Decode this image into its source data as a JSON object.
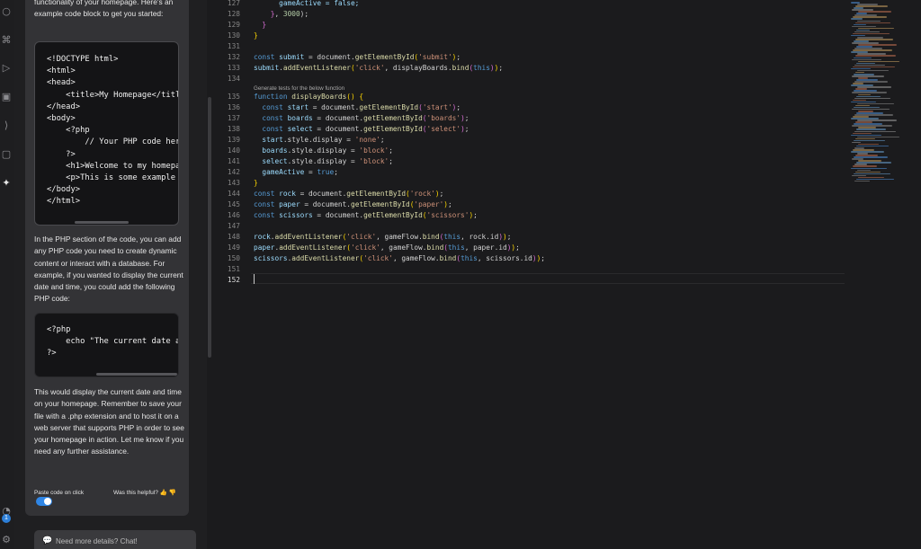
{
  "activity_bar": {
    "icons": [
      {
        "name": "search-icon",
        "glyph": "○"
      },
      {
        "name": "source-control-icon",
        "glyph": "⌘"
      },
      {
        "name": "run-debug-icon",
        "glyph": "▷"
      },
      {
        "name": "extensions-icon",
        "glyph": "▣"
      },
      {
        "name": "brackets-icon",
        "glyph": "⟩"
      },
      {
        "name": "remote-explorer-icon",
        "glyph": "▢"
      },
      {
        "name": "ai-chat-icon",
        "glyph": "✦"
      }
    ],
    "account_icon": "◔",
    "account_badge": "1",
    "settings_icon": "⚙"
  },
  "chat": {
    "intro": "functionality of your homepage. Here's an example code block to get you started:",
    "code_block_1": "<!DOCTYPE html>\n<html>\n<head>\n    <title>My Homepage</title>\n</head>\n<body>\n    <?php\n        // Your PHP code here\n    ?>\n    <h1>Welcome to my homepage</h1>\n    <p>This is some example text.</p>\n</body>\n</html>",
    "paragraph_2": "In the PHP section of the code, you can add any PHP code you need to create dynamic content or interact with a database. For example, if you wanted to display the current date and time, you could add the following PHP code:",
    "code_block_2": "<?php\n    echo \"The current date and time is \" . date(\"Y-m-d H:i:s\");\n?>",
    "paragraph_3": "This would display the current date and time on your homepage. Remember to save your file with a .php extension and to host it on a web server that supports PHP in order to see your homepage in action. Let me know if you need any further assistance.",
    "paste_label": "Paste code on click",
    "helpful_label": "Was this helpful?",
    "thumbs_up": "👍",
    "thumbs_down": "👎",
    "input_icon": "💬",
    "input_placeholder": "Need more details? Chat!"
  },
  "editor": {
    "hint": "Generate tests for the below function",
    "line_numbers": [
      "127",
      "128",
      "129",
      "130",
      "131",
      "132",
      "133",
      "134",
      "135",
      "136",
      "137",
      "138",
      "139",
      "140",
      "141",
      "142",
      "143",
      "144",
      "145",
      "146",
      "147",
      "148",
      "149",
      "150",
      "151",
      "152"
    ],
    "current_line": "152",
    "lines": [
      [
        {
          "t": "      gameActive = false;",
          "c": "var"
        }
      ],
      [
        {
          "t": "    ",
          "c": ""
        },
        {
          "t": "}",
          "c": "br2"
        },
        {
          "t": ", ",
          "c": ""
        },
        {
          "t": "3000",
          "c": "num"
        },
        {
          "t": ");",
          "c": ""
        }
      ],
      [
        {
          "t": "  ",
          "c": ""
        },
        {
          "t": "}",
          "c": "br2"
        }
      ],
      [
        {
          "t": "}",
          "c": "br1"
        }
      ],
      [],
      [
        {
          "t": "const ",
          "c": "kw"
        },
        {
          "t": "submit",
          "c": "var"
        },
        {
          "t": " = document.",
          "c": ""
        },
        {
          "t": "getElementById",
          "c": "fn"
        },
        {
          "t": "(",
          "c": "br1"
        },
        {
          "t": "'submit'",
          "c": "str"
        },
        {
          "t": ")",
          "c": "br1"
        },
        {
          "t": ";",
          "c": ""
        }
      ],
      [
        {
          "t": "submit",
          "c": "var"
        },
        {
          "t": ".",
          "c": ""
        },
        {
          "t": "addEventListener",
          "c": "fn"
        },
        {
          "t": "(",
          "c": "br1"
        },
        {
          "t": "'click'",
          "c": "str"
        },
        {
          "t": ", displayBoards.",
          "c": ""
        },
        {
          "t": "bind",
          "c": "fn"
        },
        {
          "t": "(",
          "c": "br2"
        },
        {
          "t": "this",
          "c": "kw"
        },
        {
          "t": ")",
          "c": "br2"
        },
        {
          "t": ")",
          "c": "br1"
        },
        {
          "t": ";",
          "c": ""
        }
      ],
      [],
      [
        {
          "t": "function ",
          "c": "kw"
        },
        {
          "t": "displayBoards",
          "c": "fn"
        },
        {
          "t": "() {",
          "c": "br1"
        }
      ],
      [
        {
          "t": "  const ",
          "c": "kw"
        },
        {
          "t": "start",
          "c": "var"
        },
        {
          "t": " = document.",
          "c": ""
        },
        {
          "t": "getElementById",
          "c": "fn"
        },
        {
          "t": "(",
          "c": "br2"
        },
        {
          "t": "'start'",
          "c": "str"
        },
        {
          "t": ")",
          "c": "br2"
        },
        {
          "t": ";",
          "c": ""
        }
      ],
      [
        {
          "t": "  const ",
          "c": "kw"
        },
        {
          "t": "boards",
          "c": "var"
        },
        {
          "t": " = document.",
          "c": ""
        },
        {
          "t": "getElementById",
          "c": "fn"
        },
        {
          "t": "(",
          "c": "br2"
        },
        {
          "t": "'boards'",
          "c": "str"
        },
        {
          "t": ")",
          "c": "br2"
        },
        {
          "t": ";",
          "c": ""
        }
      ],
      [
        {
          "t": "  const ",
          "c": "kw"
        },
        {
          "t": "select",
          "c": "var"
        },
        {
          "t": " = document.",
          "c": ""
        },
        {
          "t": "getElementById",
          "c": "fn"
        },
        {
          "t": "(",
          "c": "br2"
        },
        {
          "t": "'select'",
          "c": "str"
        },
        {
          "t": ")",
          "c": "br2"
        },
        {
          "t": ";",
          "c": ""
        }
      ],
      [
        {
          "t": "  start",
          "c": "var"
        },
        {
          "t": ".style.display = ",
          "c": ""
        },
        {
          "t": "'none'",
          "c": "str"
        },
        {
          "t": ";",
          "c": ""
        }
      ],
      [
        {
          "t": "  boards",
          "c": "var"
        },
        {
          "t": ".style.display = ",
          "c": ""
        },
        {
          "t": "'block'",
          "c": "str"
        },
        {
          "t": ";",
          "c": ""
        }
      ],
      [
        {
          "t": "  select",
          "c": "var"
        },
        {
          "t": ".style.display = ",
          "c": ""
        },
        {
          "t": "'block'",
          "c": "str"
        },
        {
          "t": ";",
          "c": ""
        }
      ],
      [
        {
          "t": "  gameActive",
          "c": "var"
        },
        {
          "t": " = ",
          "c": ""
        },
        {
          "t": "true",
          "c": "kw"
        },
        {
          "t": ";",
          "c": ""
        }
      ],
      [
        {
          "t": "}",
          "c": "br1"
        }
      ],
      [
        {
          "t": "const ",
          "c": "kw"
        },
        {
          "t": "rock",
          "c": "var"
        },
        {
          "t": " = document.",
          "c": ""
        },
        {
          "t": "getElementById",
          "c": "fn"
        },
        {
          "t": "(",
          "c": "br1"
        },
        {
          "t": "'rock'",
          "c": "str"
        },
        {
          "t": ")",
          "c": "br1"
        },
        {
          "t": ";",
          "c": ""
        }
      ],
      [
        {
          "t": "const ",
          "c": "kw"
        },
        {
          "t": "paper",
          "c": "var"
        },
        {
          "t": " = document.",
          "c": ""
        },
        {
          "t": "getElementById",
          "c": "fn"
        },
        {
          "t": "(",
          "c": "br1"
        },
        {
          "t": "'paper'",
          "c": "str"
        },
        {
          "t": ")",
          "c": "br1"
        },
        {
          "t": ";",
          "c": ""
        }
      ],
      [
        {
          "t": "const ",
          "c": "kw"
        },
        {
          "t": "scissors",
          "c": "var"
        },
        {
          "t": " = document.",
          "c": ""
        },
        {
          "t": "getElementById",
          "c": "fn"
        },
        {
          "t": "(",
          "c": "br1"
        },
        {
          "t": "'scissors'",
          "c": "str"
        },
        {
          "t": ")",
          "c": "br1"
        },
        {
          "t": ";",
          "c": ""
        }
      ],
      [],
      [
        {
          "t": "rock",
          "c": "var"
        },
        {
          "t": ".",
          "c": ""
        },
        {
          "t": "addEventListener",
          "c": "fn"
        },
        {
          "t": "(",
          "c": "br1"
        },
        {
          "t": "'click'",
          "c": "str"
        },
        {
          "t": ", gameFlow.",
          "c": ""
        },
        {
          "t": "bind",
          "c": "fn"
        },
        {
          "t": "(",
          "c": "br2"
        },
        {
          "t": "this",
          "c": "kw"
        },
        {
          "t": ", rock.id",
          "c": ""
        },
        {
          "t": ")",
          "c": "br2"
        },
        {
          "t": ")",
          "c": "br1"
        },
        {
          "t": ";",
          "c": ""
        }
      ],
      [
        {
          "t": "paper",
          "c": "var"
        },
        {
          "t": ".",
          "c": ""
        },
        {
          "t": "addEventListener",
          "c": "fn"
        },
        {
          "t": "(",
          "c": "br1"
        },
        {
          "t": "'click'",
          "c": "str"
        },
        {
          "t": ", gameFlow.",
          "c": ""
        },
        {
          "t": "bind",
          "c": "fn"
        },
        {
          "t": "(",
          "c": "br2"
        },
        {
          "t": "this",
          "c": "kw"
        },
        {
          "t": ", paper.id",
          "c": ""
        },
        {
          "t": ")",
          "c": "br2"
        },
        {
          "t": ")",
          "c": "br1"
        },
        {
          "t": ";",
          "c": ""
        }
      ],
      [
        {
          "t": "scissors",
          "c": "var"
        },
        {
          "t": ".",
          "c": ""
        },
        {
          "t": "addEventListener",
          "c": "fn"
        },
        {
          "t": "(",
          "c": "br1"
        },
        {
          "t": "'click'",
          "c": "str"
        },
        {
          "t": ", gameFlow.",
          "c": ""
        },
        {
          "t": "bind",
          "c": "fn"
        },
        {
          "t": "(",
          "c": "br2"
        },
        {
          "t": "this",
          "c": "kw"
        },
        {
          "t": ", scissors.id",
          "c": ""
        },
        {
          "t": ")",
          "c": "br2"
        },
        {
          "t": ")",
          "c": "br1"
        },
        {
          "t": ";",
          "c": ""
        }
      ],
      [],
      []
    ]
  },
  "colors": {
    "keyword": "#569cd6",
    "function": "#dcdcaa",
    "string": "#ce9178",
    "variable": "#9cdcfe",
    "accent": "#2f86e6",
    "thumbs": "#f2b233"
  }
}
